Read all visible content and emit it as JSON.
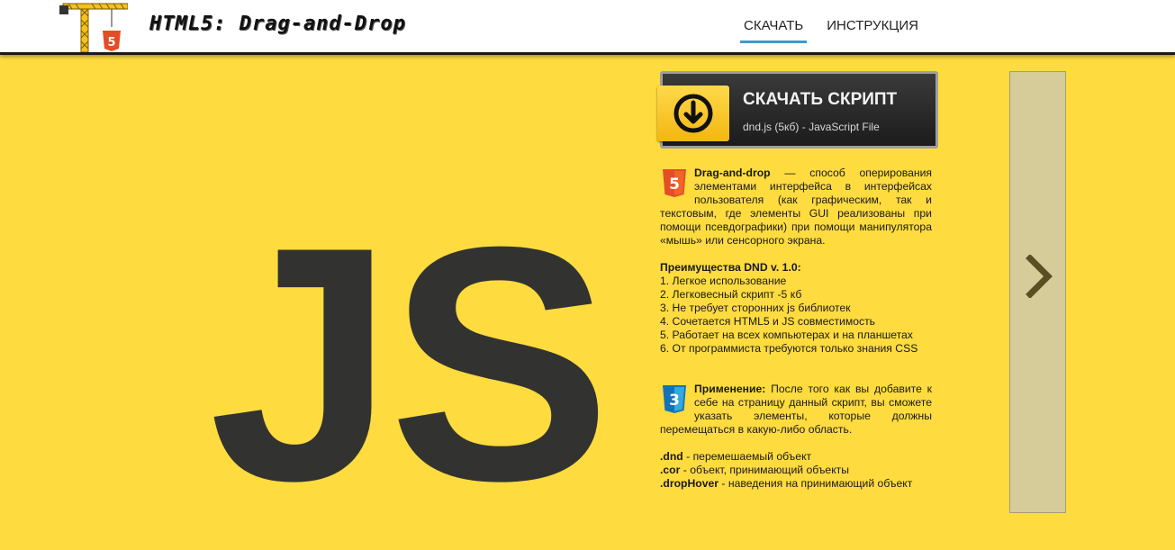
{
  "header": {
    "title": "HTML5: Drag-and-Drop",
    "nav": [
      {
        "label": "СКАЧАТЬ",
        "active": true
      },
      {
        "label": "ИНСТРУКЦИЯ",
        "active": false
      }
    ]
  },
  "hero": {
    "logo_text": "JS"
  },
  "download": {
    "title": "СКАЧАТЬ СКРИПТ",
    "subtitle": "dnd.js (5кб) - JavaScript File",
    "icon": "download-arrow-icon"
  },
  "info": {
    "intro_term": "Drag-and-drop",
    "intro_text": " — способ оперирования элементами интерфейса в интерфейсах пользователя (как графическим, так и текстовым, где элементы GUI реализованы при помощи псевдографики) при помощи манипулятора «мышь» или сенсорного экрана.",
    "advantages_title": "Преимущества DND v. 1.0:",
    "advantages": [
      "1. Легкое использование",
      "2. Легковесный скрипт -5 кб",
      "3. Не требует сторонних js библиотек",
      "4. Сочетается HTML5 и JS совместимость",
      "5. Работает на всех компьютерах и на планшетах",
      "6. От программиста требуются только знания CSS"
    ],
    "usage_term": "Применение:",
    "usage_text": " После того как вы добавите к себе на страницу данный скрипт, вы сможете указать элементы, которые должны перемещаться в какую-либо область.",
    "classes": [
      {
        "name": ".dnd",
        "desc": " - перемешаемый объект"
      },
      {
        "name": ".cor",
        "desc": " - объект, принимающий объекты"
      },
      {
        "name": ".dropHover",
        "desc": " - наведения на принимающий объект"
      }
    ],
    "html5_badge_text": "5",
    "css3_badge_text": "3"
  },
  "side_panel": {
    "icon": "chevron-right-icon"
  },
  "colors": {
    "background": "#fedb3f",
    "js_text": "#323330",
    "nav_underline": "#3b9ccb",
    "html5_orange": "#e44d26",
    "css3_blue": "#1572b6",
    "panel": "#d6cc9a"
  }
}
